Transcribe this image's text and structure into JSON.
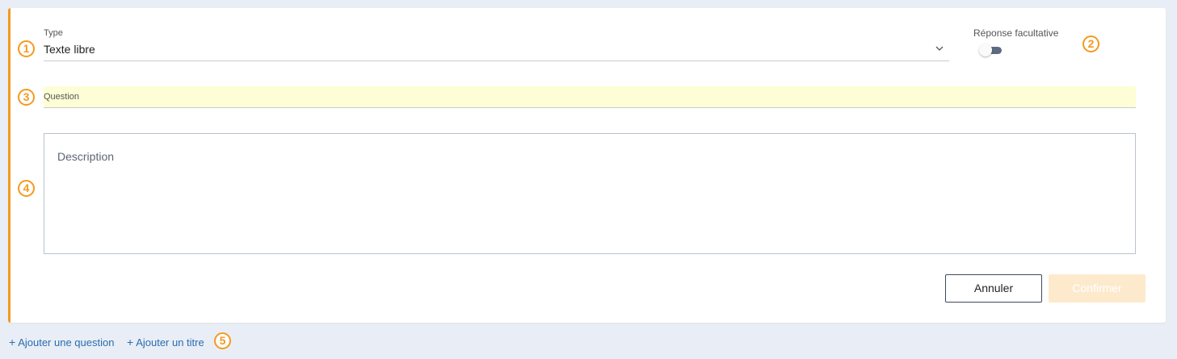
{
  "form": {
    "type_label": "Type",
    "type_value": "Texte libre",
    "optional_label": "Réponse facultative",
    "optional_enabled": false,
    "question_label": "Question",
    "description_placeholder": "Description",
    "cancel_label": "Annuler",
    "confirm_label": "Confirmer"
  },
  "footer": {
    "add_question_label": "Ajouter une question",
    "add_title_label": "Ajouter un titre"
  },
  "markers": {
    "m1": "1",
    "m2": "2",
    "m3": "3",
    "m4": "4",
    "m5": "5"
  },
  "icons": {
    "dropdown": "chevron-down-icon",
    "plus": "plus-icon"
  },
  "colors": {
    "accent": "#f39a1e",
    "link": "#2a6db0",
    "question_highlight": "#fdfed6",
    "confirm_disabled": "#fdeacd",
    "toggle_track": "#5c6b82"
  }
}
